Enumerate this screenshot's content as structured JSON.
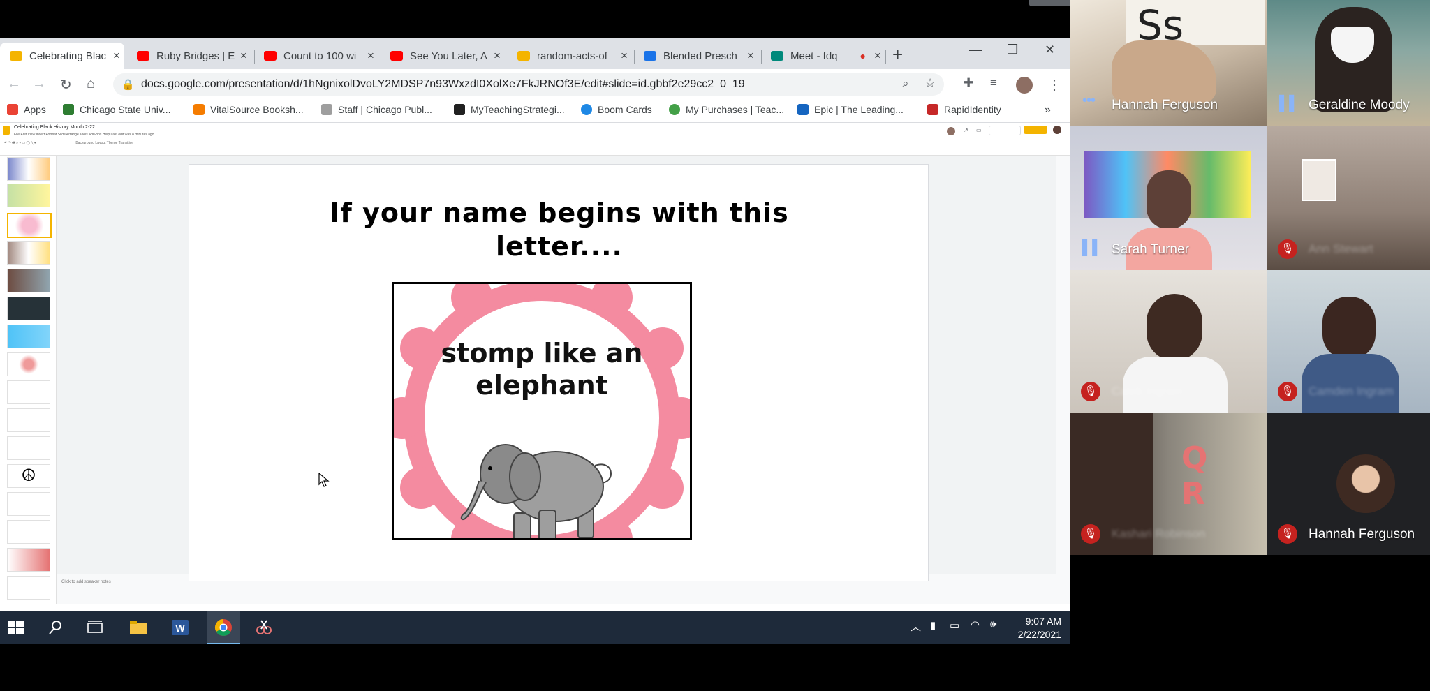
{
  "browser": {
    "tabs": [
      {
        "title": "Celebrating Blac",
        "favicon_color": "#f4b400"
      },
      {
        "title": "Ruby Bridges | E",
        "favicon_color": "#ff0000"
      },
      {
        "title": "Count to 100 wi",
        "favicon_color": "#ff0000"
      },
      {
        "title": "See You Later, A",
        "favicon_color": "#ff0000"
      },
      {
        "title": "random-acts-of",
        "favicon_color": "#f4b400"
      },
      {
        "title": "Blended Presch",
        "favicon_color": "#1a73e8"
      },
      {
        "title": "Meet - fdq",
        "favicon_color": "#00897b"
      }
    ],
    "new_tab": "+",
    "url": "docs.google.com/presentation/d/1hNgnixolDvoLY2MDSP7n93WxzdI0XolXe7FkJRNOf3E/edit#slide=id.gbbf2e29cc2_0_19",
    "bookmarks": [
      {
        "label": "Apps",
        "color": "#ea4335"
      },
      {
        "label": "Chicago State Univ...",
        "color": "#2e7d32"
      },
      {
        "label": "VitalSource Booksh...",
        "color": "#f57c00"
      },
      {
        "label": "Staff | Chicago Publ...",
        "color": "#9e9e9e"
      },
      {
        "label": "MyTeachingStrategi...",
        "color": "#212121"
      },
      {
        "label": "Boom Cards",
        "color": "#1e88e5"
      },
      {
        "label": "My Purchases | Teac...",
        "color": "#43a047"
      },
      {
        "label": "Epic | The Leading...",
        "color": "#1565c0"
      },
      {
        "label": "RapidIdentity",
        "color": "#c62828"
      }
    ],
    "more_bookmarks": "»"
  },
  "slides": {
    "doc_title": "Celebrating Black History Month 2-22",
    "menus": "File  Edit  View  Insert  Format  Slide  Arrange  Tools  Add-ons  Help  Last edit was 8 minutes ago",
    "toolbar_items": "Background   Layout   Theme   Transition",
    "headline": "If your name begins with this letter....",
    "card_text": "stomp like an elephant",
    "notes_placeholder": "Click to add speaker notes"
  },
  "taskbar": {
    "time": "9:07 AM",
    "date": "2/22/2021"
  },
  "meet": {
    "participants": [
      {
        "name": "Hannah Ferguson",
        "status": "speaking-dots",
        "visible_name": true
      },
      {
        "name": "Geraldine Moody",
        "status": "speaking-bars",
        "visible_name": true
      },
      {
        "name": "Sarah Turner",
        "status": "speaking-bars",
        "visible_name": true
      },
      {
        "name": "Ann Stewart",
        "status": "muted",
        "visible_name": false
      },
      {
        "name": "Caleb Ingram",
        "status": "muted",
        "visible_name": false
      },
      {
        "name": "Camden Ingram",
        "status": "muted",
        "visible_name": false
      },
      {
        "name": "Kashari Robinson",
        "status": "muted",
        "visible_name": false
      },
      {
        "name": "Hannah Ferguson",
        "status": "muted",
        "visible_name": true
      }
    ],
    "tile_letters": "Ss",
    "background_letters": "Q R"
  },
  "colors": {
    "mic_muted": "#c5221f",
    "speaking": "#8ab4f8",
    "taskbar": "#1e2a3a",
    "card_border": "#f48ba0"
  }
}
